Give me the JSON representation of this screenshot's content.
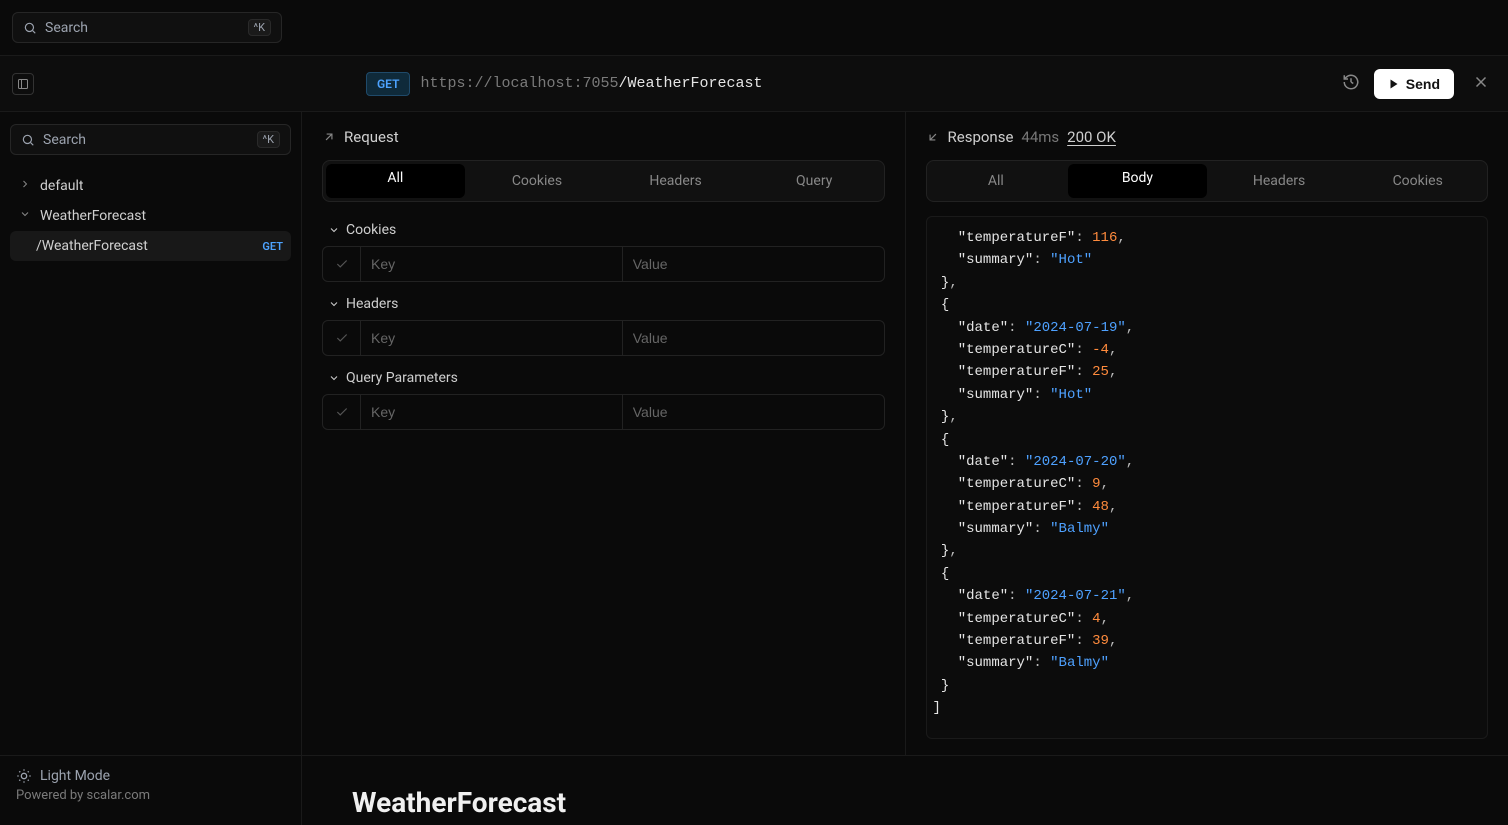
{
  "top_search": {
    "placeholder": "Search",
    "kbd": "^K"
  },
  "commandbar": {
    "method": "GET",
    "url_base": "https://localhost:7055",
    "url_path": "/WeatherForecast",
    "send_label": "Send"
  },
  "sidebar": {
    "search": {
      "placeholder": "Search",
      "kbd": "^K"
    },
    "items": [
      {
        "label": "default",
        "expanded": false
      },
      {
        "label": "WeatherForecast",
        "expanded": true,
        "children": [
          {
            "label": "/WeatherForecast",
            "method": "GET",
            "active": true
          }
        ]
      }
    ]
  },
  "request": {
    "title": "Request",
    "tabs": [
      "All",
      "Cookies",
      "Headers",
      "Query"
    ],
    "active_tab": "All",
    "sections": [
      {
        "label": "Cookies",
        "key_ph": "Key",
        "val_ph": "Value"
      },
      {
        "label": "Headers",
        "key_ph": "Key",
        "val_ph": "Value"
      },
      {
        "label": "Query Parameters",
        "key_ph": "Key",
        "val_ph": "Value"
      }
    ]
  },
  "response": {
    "title": "Response",
    "latency": "44ms",
    "status": "200 OK",
    "tabs": [
      "All",
      "Body",
      "Headers",
      "Cookies"
    ],
    "active_tab": "Body",
    "body_lines": [
      [
        {
          "t": "   "
        },
        {
          "k": "key",
          "v": "\"temperatureF\""
        },
        {
          "t": ": "
        },
        {
          "k": "num",
          "v": "116"
        },
        {
          "t": ","
        }
      ],
      [
        {
          "t": "   "
        },
        {
          "k": "key",
          "v": "\"summary\""
        },
        {
          "t": ": "
        },
        {
          "k": "str",
          "v": "\"Hot\""
        }
      ],
      [
        {
          "t": " "
        },
        {
          "k": "brace",
          "v": "}"
        },
        {
          "t": ","
        }
      ],
      [
        {
          "t": " "
        },
        {
          "k": "brace",
          "v": "{"
        }
      ],
      [
        {
          "t": "   "
        },
        {
          "k": "key",
          "v": "\"date\""
        },
        {
          "t": ": "
        },
        {
          "k": "str",
          "v": "\"2024-07-19\""
        },
        {
          "t": ","
        }
      ],
      [
        {
          "t": "   "
        },
        {
          "k": "key",
          "v": "\"temperatureC\""
        },
        {
          "t": ": "
        },
        {
          "k": "num",
          "v": "-4"
        },
        {
          "t": ","
        }
      ],
      [
        {
          "t": "   "
        },
        {
          "k": "key",
          "v": "\"temperatureF\""
        },
        {
          "t": ": "
        },
        {
          "k": "num",
          "v": "25"
        },
        {
          "t": ","
        }
      ],
      [
        {
          "t": "   "
        },
        {
          "k": "key",
          "v": "\"summary\""
        },
        {
          "t": ": "
        },
        {
          "k": "str",
          "v": "\"Hot\""
        }
      ],
      [
        {
          "t": " "
        },
        {
          "k": "brace",
          "v": "}"
        },
        {
          "t": ","
        }
      ],
      [
        {
          "t": " "
        },
        {
          "k": "brace",
          "v": "{"
        }
      ],
      [
        {
          "t": "   "
        },
        {
          "k": "key",
          "v": "\"date\""
        },
        {
          "t": ": "
        },
        {
          "k": "str",
          "v": "\"2024-07-20\""
        },
        {
          "t": ","
        }
      ],
      [
        {
          "t": "   "
        },
        {
          "k": "key",
          "v": "\"temperatureC\""
        },
        {
          "t": ": "
        },
        {
          "k": "num",
          "v": "9"
        },
        {
          "t": ","
        }
      ],
      [
        {
          "t": "   "
        },
        {
          "k": "key",
          "v": "\"temperatureF\""
        },
        {
          "t": ": "
        },
        {
          "k": "num",
          "v": "48"
        },
        {
          "t": ","
        }
      ],
      [
        {
          "t": "   "
        },
        {
          "k": "key",
          "v": "\"summary\""
        },
        {
          "t": ": "
        },
        {
          "k": "str",
          "v": "\"Balmy\""
        }
      ],
      [
        {
          "t": " "
        },
        {
          "k": "brace",
          "v": "}"
        },
        {
          "t": ","
        }
      ],
      [
        {
          "t": " "
        },
        {
          "k": "brace",
          "v": "{"
        }
      ],
      [
        {
          "t": "   "
        },
        {
          "k": "key",
          "v": "\"date\""
        },
        {
          "t": ": "
        },
        {
          "k": "str",
          "v": "\"2024-07-21\""
        },
        {
          "t": ","
        }
      ],
      [
        {
          "t": "   "
        },
        {
          "k": "key",
          "v": "\"temperatureC\""
        },
        {
          "t": ": "
        },
        {
          "k": "num",
          "v": "4"
        },
        {
          "t": ","
        }
      ],
      [
        {
          "t": "   "
        },
        {
          "k": "key",
          "v": "\"temperatureF\""
        },
        {
          "t": ": "
        },
        {
          "k": "num",
          "v": "39"
        },
        {
          "t": ","
        }
      ],
      [
        {
          "t": "   "
        },
        {
          "k": "key",
          "v": "\"summary\""
        },
        {
          "t": ": "
        },
        {
          "k": "str",
          "v": "\"Balmy\""
        }
      ],
      [
        {
          "t": " "
        },
        {
          "k": "brace",
          "v": "}"
        }
      ],
      [
        {
          "k": "brace",
          "v": "]"
        }
      ]
    ]
  },
  "footer": {
    "theme_label": "Light Mode",
    "powered_by": "Powered by scalar.com",
    "page_title": "WeatherForecast"
  }
}
